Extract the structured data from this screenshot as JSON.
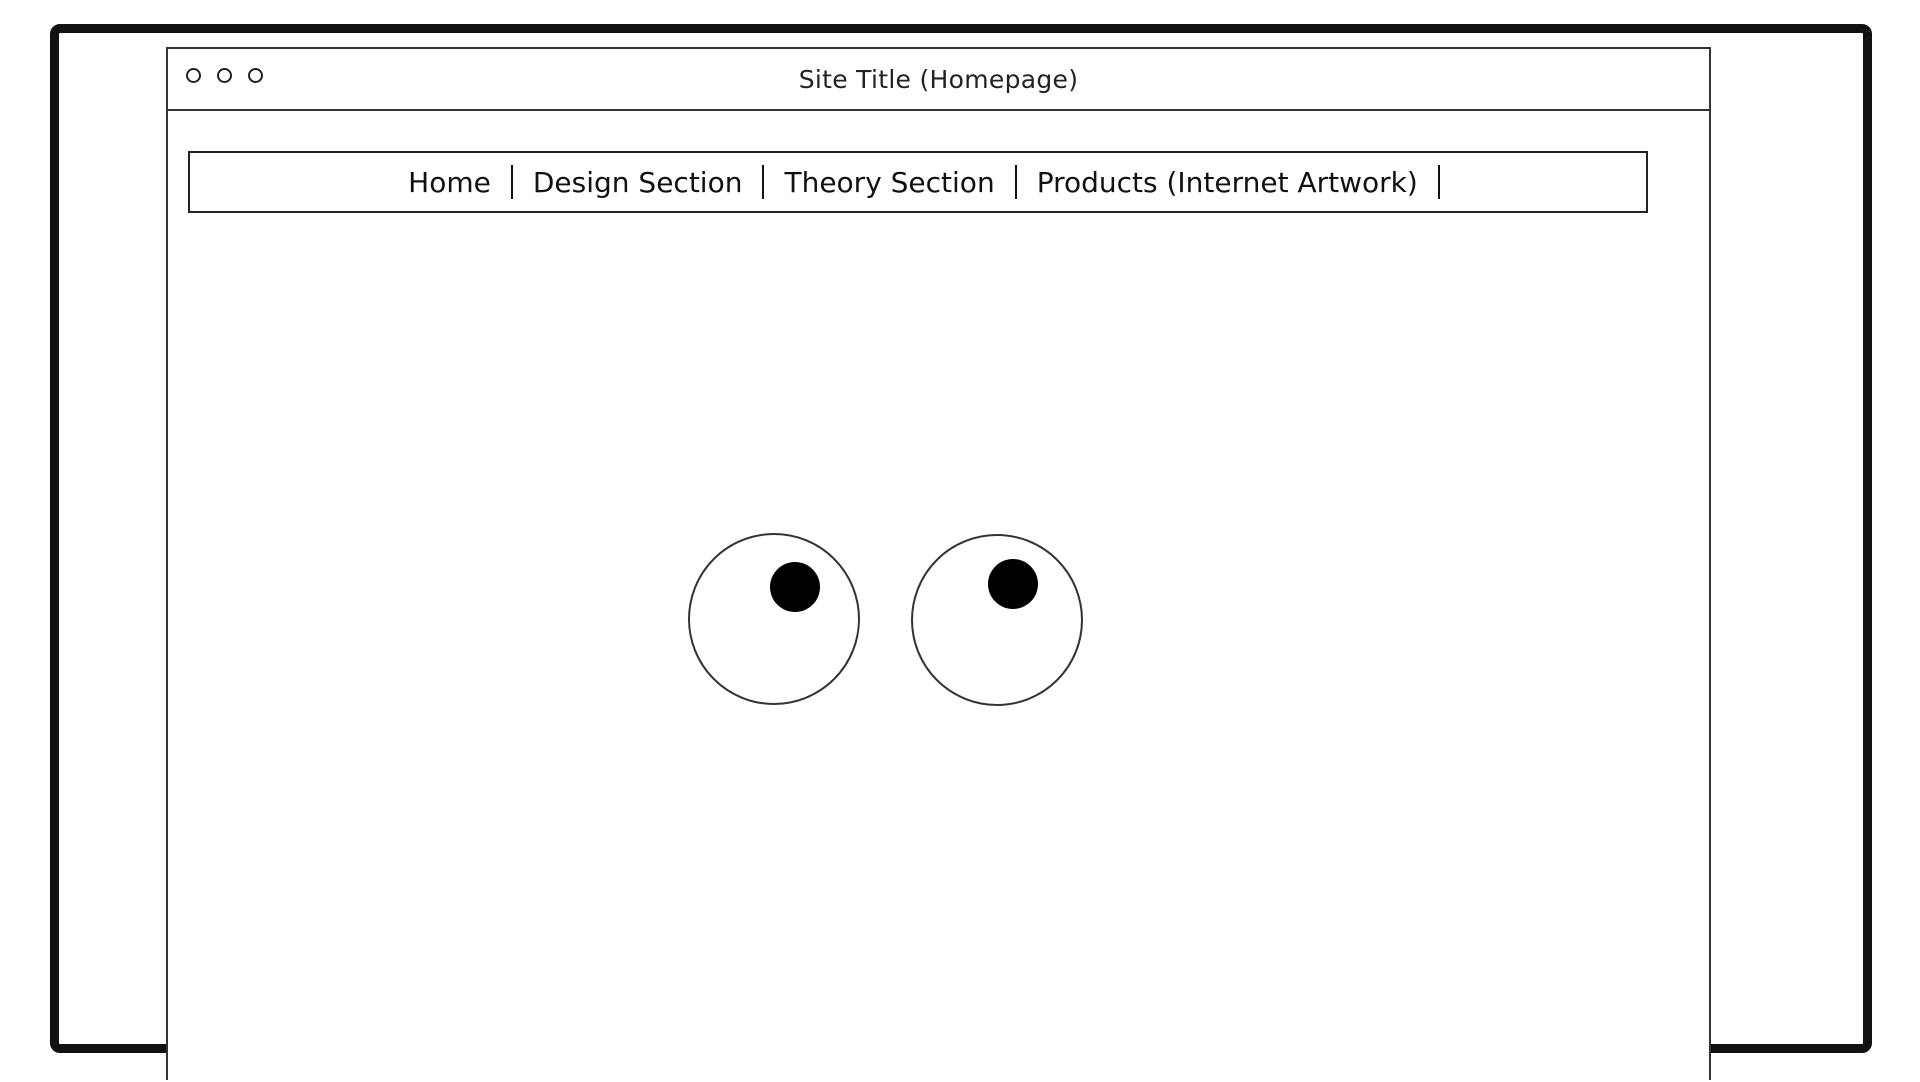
{
  "window": {
    "title": "Site Title (Homepage)",
    "controls": [
      "window-dot-icon",
      "window-dot-icon",
      "window-dot-icon"
    ]
  },
  "nav": {
    "items": [
      {
        "label": "Home"
      },
      {
        "label": "Design Section"
      },
      {
        "label": "Theory Section"
      },
      {
        "label": "Products (Internet Artwork)"
      }
    ]
  },
  "content": {
    "graphic": "googly-eyes-icon"
  },
  "colors": {
    "ink": "#111111",
    "background": "#ffffff"
  }
}
